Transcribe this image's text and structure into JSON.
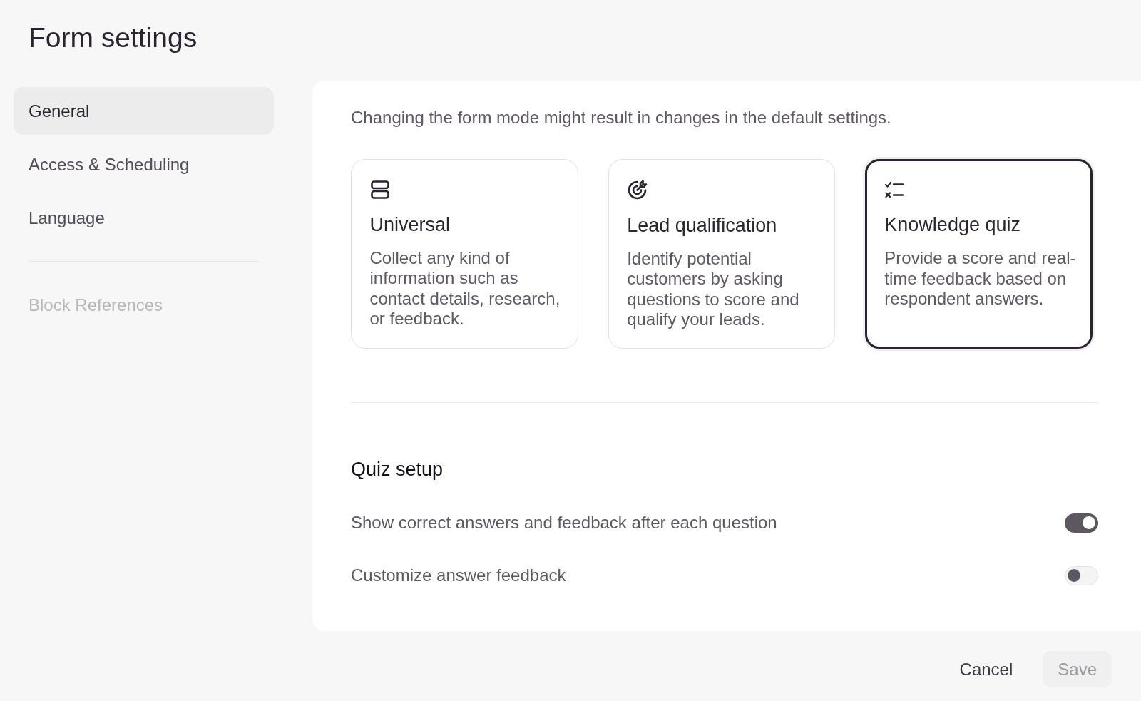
{
  "title": "Form settings",
  "sidebar": {
    "items": [
      {
        "label": "General",
        "selected": true
      },
      {
        "label": "Access & Scheduling",
        "selected": false
      },
      {
        "label": "Language",
        "selected": false
      }
    ],
    "references": [
      {
        "label": "Block References",
        "disabled": true
      }
    ]
  },
  "notice": "Changing the form mode might result in changes in the default settings.",
  "modes": [
    {
      "kind": "universal",
      "title": "Universal",
      "description": "Collect any kind of information such as contact details, research, or feedback.",
      "selected": false
    },
    {
      "kind": "lead",
      "title": "Lead qualification",
      "description": "Identify potential customers by asking questions to score and qualify your leads.",
      "selected": false
    },
    {
      "kind": "quiz",
      "title": "Knowledge quiz",
      "description": "Provide a score and real-time feedback based on respondent answers.",
      "selected": true
    }
  ],
  "quiz_setup": {
    "heading": "Quiz setup",
    "options": [
      {
        "label": "Show correct answers and feedback after each question",
        "on": true
      },
      {
        "label": "Customize answer feedback",
        "on": false
      }
    ]
  },
  "footer": {
    "buttons": [
      {
        "label": "Cancel",
        "disabled": false
      },
      {
        "label": "Save",
        "disabled": true
      }
    ]
  }
}
